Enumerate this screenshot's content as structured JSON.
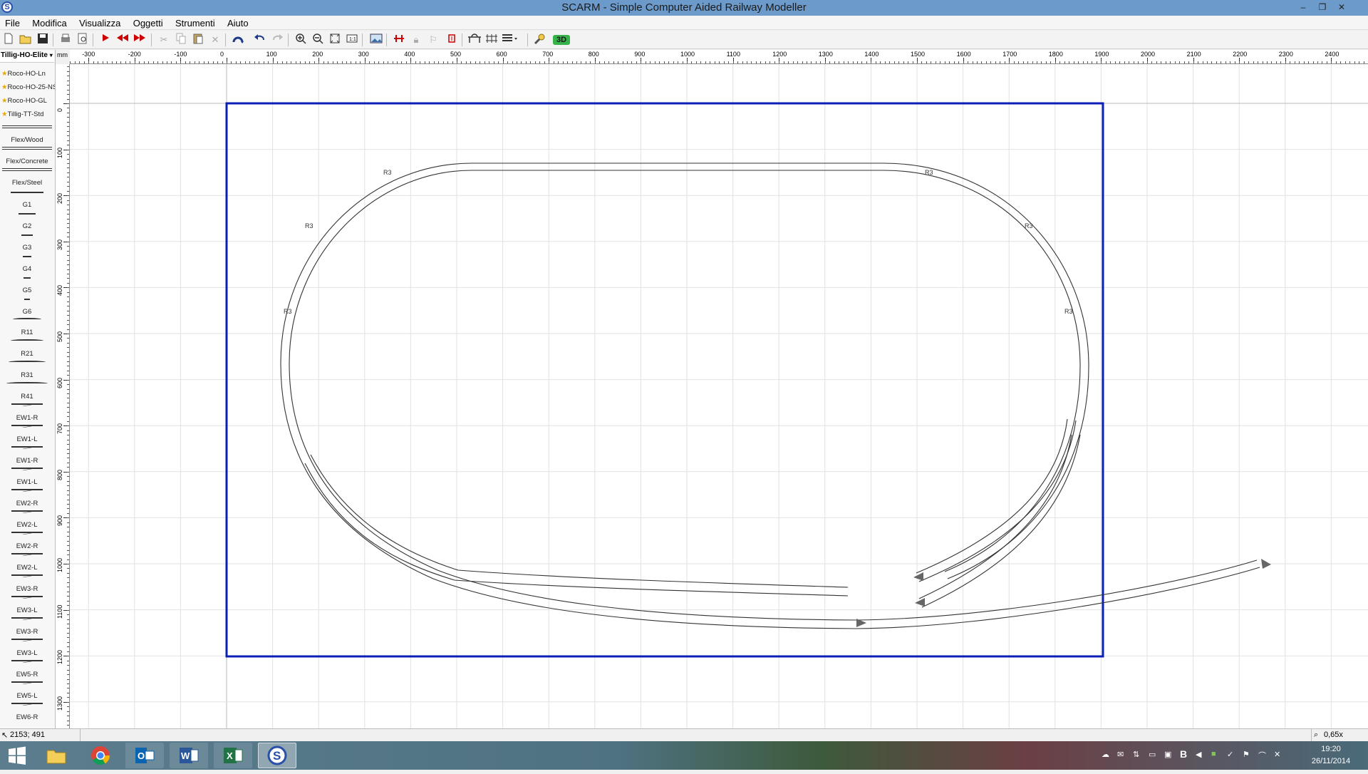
{
  "window": {
    "title": "SCARM - Simple Computer Aided Railway Modeller",
    "app_icon": "S",
    "minimize": "–",
    "restore": "❐",
    "close": "✕"
  },
  "menu": [
    "File",
    "Modifica",
    "Visualizza",
    "Oggetti",
    "Strumenti",
    "Aiuto"
  ],
  "toolbar": {
    "icons": [
      "new-icon",
      "open-icon",
      "save-icon",
      "print-icon",
      "print-preview-icon",
      "play-icon",
      "rewind-icon",
      "forward-icon",
      "cut-icon",
      "copy-icon",
      "paste-icon",
      "delete-icon",
      "rotate-icon",
      "undo-icon",
      "redo-icon",
      "zoom-in-icon",
      "zoom-out-icon",
      "zoom-fit-icon",
      "zoom-page-icon",
      "image-icon",
      "track-split-icon",
      "lock-icon",
      "flag-icon",
      "eraser-icon",
      "bridge-icon",
      "grid-icon",
      "layers-icon",
      "magnify-icon",
      "3d-icon"
    ],
    "label_3d": "3D"
  },
  "library": {
    "selected": "Tillig-HO-Elite",
    "unit": "mm",
    "favorites": [
      "Roco-HO-Ln",
      "Roco-HO-25-NS",
      "Roco-HO-GL",
      "Tillig-TT-Std"
    ],
    "tracks": [
      "Flex/Wood",
      "Flex/Concrete",
      "Flex/Steel",
      "G1",
      "G2",
      "G3",
      "G4",
      "G5",
      "G6",
      "R11",
      "R21",
      "R31",
      "R41",
      "EW1-R",
      "EW1-L",
      "EW1-R",
      "EW1-L",
      "EW2-R",
      "EW2-L",
      "EW2-R",
      "EW2-L",
      "EW3-R",
      "EW3-L",
      "EW3-R",
      "EW3-L",
      "EW5-R",
      "EW5-L",
      "EW6-R"
    ]
  },
  "ruler": {
    "h_ticks": [
      "-300",
      "-200",
      "-100",
      "0",
      "100",
      "200",
      "300",
      "400",
      "500",
      "600",
      "700",
      "800",
      "900",
      "1000",
      "1100",
      "1200",
      "1300",
      "1400",
      "1500",
      "1600",
      "1700",
      "1800",
      "1900",
      "2000",
      "2100",
      "2200",
      "2300",
      "2400"
    ],
    "v_ticks": [
      "0",
      "100",
      "200",
      "300",
      "400",
      "500",
      "600",
      "700",
      "800",
      "900",
      "1000",
      "1100",
      "1200",
      "1300"
    ]
  },
  "layout": {
    "board_color": "#0b1fb5",
    "track_labels": [
      "R3",
      "R3",
      "R3",
      "R3",
      "R3",
      "R3"
    ]
  },
  "status": {
    "coords": "2153; 491",
    "zoom": "0,65x"
  },
  "taskbar": {
    "apps": [
      "windows-start-icon",
      "file-explorer-icon",
      "chrome-icon",
      "outlook-icon",
      "word-icon",
      "excel-icon",
      "scarm-icon"
    ],
    "time": "19:20",
    "date": "26/11/2014"
  }
}
